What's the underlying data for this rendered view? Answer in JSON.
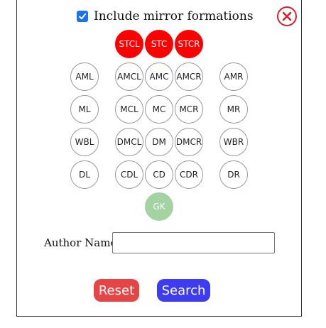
{
  "header": {
    "mirror_label": "Include mirror formations",
    "mirror_checked": true
  },
  "positions": {
    "stcl": "STCL",
    "stc": "STC",
    "stcr": "STCR",
    "aml": "AML",
    "amcl": "AMCL",
    "amc": "AMC",
    "amcr": "AMCR",
    "amr": "AMR",
    "ml": "ML",
    "mcl": "MCL",
    "mc": "MC",
    "mcr": "MCR",
    "mr": "MR",
    "wbl": "WBL",
    "dmcl": "DMCL",
    "dm": "DM",
    "dmcr": "DMCR",
    "wbr": "WBR",
    "dl": "DL",
    "cdl": "CDL",
    "cd": "CD",
    "cdr": "CDR",
    "dr": "DR",
    "gk": "GK"
  },
  "selected_positions": [
    "STCL",
    "STC",
    "STCR"
  ],
  "author": {
    "label": "Author Name:",
    "value": ""
  },
  "buttons": {
    "reset": "Reset",
    "search": "Search"
  },
  "colors": {
    "selected": "#ff0000",
    "goalkeeper": "#a3d3a3",
    "reset": "#e54545",
    "search": "#3e3cf0",
    "close": "#d6222a",
    "checkbox": "#1a73e8"
  },
  "icons": {
    "close": "close-circle-icon",
    "check": "checkmark-icon"
  }
}
